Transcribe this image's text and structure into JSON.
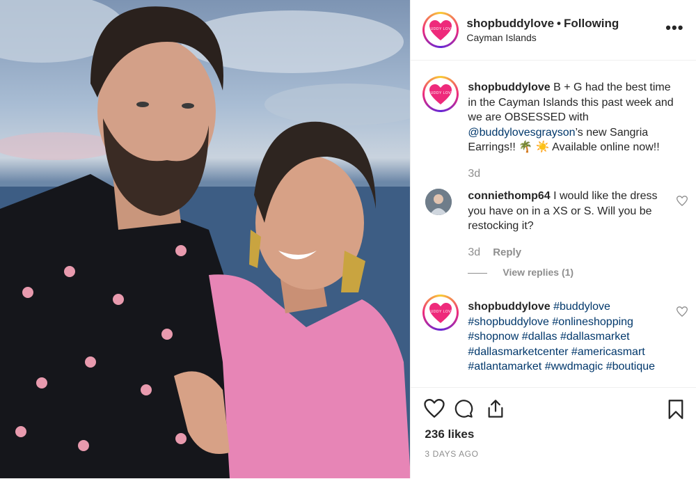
{
  "colors": {
    "brand_pink": "#ee2a7b",
    "link": "#00376b",
    "muted": "#8e8e8e",
    "text": "#262626"
  },
  "post": {
    "username": "shopbuddylove",
    "separator": "•",
    "follow_status": "Following",
    "location": "Cayman Islands",
    "more_icon": "more-horizontal-icon",
    "brand_avatar_text": "BUDDY LOVE"
  },
  "caption": {
    "username": "shopbuddylove",
    "text_1": "B + G had the best time in the Cayman Islands this past week and we are OBSESSED with ",
    "mention": "@buddylovesgrayson",
    "text_2": "’s new Sangria Earrings!! 🌴 ☀️  Available online now!!",
    "time": "3d"
  },
  "comment": {
    "username": "conniethomp64",
    "text": "I would like the dress you have on in a XS or S. Will you be restocking it?",
    "time": "3d",
    "reply_label": "Reply",
    "view_replies": "View replies (1)"
  },
  "comment2": {
    "username": "shopbuddylove",
    "hashtags": "#buddylove #shopbuddylove #onlineshopping #shopnow #dallas #dallasmarket #dallasmarketcenter #americasmart #atlantamarket #wwdmagic #boutique"
  },
  "footer": {
    "likes": "236 likes",
    "date": "3 DAYS AGO"
  }
}
